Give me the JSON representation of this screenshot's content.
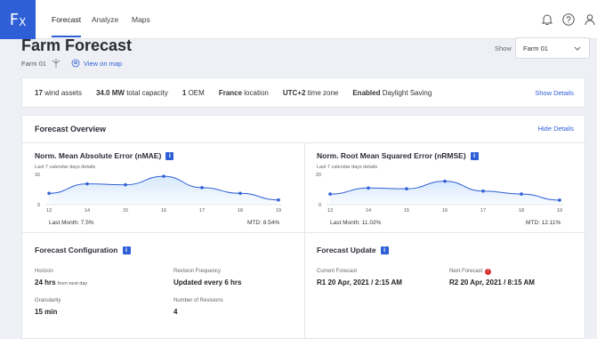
{
  "app": {
    "logo": "F",
    "logo_sub": "X"
  },
  "nav": {
    "tabs": [
      {
        "label": "Forecast"
      },
      {
        "label": "Analyze"
      },
      {
        "label": "Maps"
      }
    ]
  },
  "header": {
    "title": "Farm Forecast",
    "farm": "Farm 01",
    "map_link": "View on map",
    "show_label": "Show",
    "selected_farm": "Farm 01"
  },
  "summary": {
    "assets_count": "17",
    "assets_label": "wind assets",
    "capacity": "34.0 MW",
    "capacity_label": "total capacity",
    "oem_count": "1",
    "oem_label": "OEM",
    "location": "France",
    "location_label": "location",
    "tz": "UTC+2",
    "tz_label": "time zone",
    "dst_state": "Enabled",
    "dst_label": "Daylight Saving",
    "show_details": "Show Details"
  },
  "overview": {
    "title": "Forecast Overview",
    "hide_details": "Hide Details",
    "nmae": {
      "title": "Norm. Mean Absolute Error (nMAE)",
      "subtitle": "Last 7 calendar days details",
      "last_month": "Last Month: 7.5%",
      "mtd": "MTD: 8.54%"
    },
    "nrmse": {
      "title": "Norm. Root Mean Squared Error (nRMSE)",
      "subtitle": "Last 7 calendar days details",
      "last_month": "Last Month: 11.02%",
      "mtd": "MTD: 12.11%"
    }
  },
  "config": {
    "title": "Forecast Configuration",
    "horizon_label": "Horizon",
    "horizon_value": "24 hrs",
    "horizon_suffix": "from next day",
    "revision_label": "Revision Frequency",
    "revision_value": "Updated every 6 hrs",
    "granularity_label": "Granularity",
    "granularity_value": "15 min",
    "revisions_label": "Number of Revisions",
    "revisions_value": "4"
  },
  "update": {
    "title": "Forecast Update",
    "current_label": "Current Forecast",
    "current_value": "R1 20 Apr, 2021 / 2:15 AM",
    "next_label": "Next Forecast",
    "next_value": "R2 20 Apr, 2021 / 8:15 AM",
    "next_badge": "!"
  },
  "colors": {
    "accent": "#2f5fd6",
    "line": "#2f5fd6",
    "fill": "#d7e8fb",
    "alert": "#d93030"
  },
  "chart_data": [
    {
      "type": "area",
      "title": "Norm. Mean Absolute Error (nMAE)",
      "x": [
        13,
        14,
        15,
        16,
        17,
        18,
        19
      ],
      "values": [
        6,
        11,
        10.5,
        15,
        9,
        6,
        2.5
      ],
      "ylim": [
        0,
        16
      ],
      "yticks": [
        0,
        16
      ]
    },
    {
      "type": "area",
      "title": "Norm. Root Mean Squared Error (nRMSE)",
      "x": [
        13,
        14,
        15,
        16,
        17,
        18,
        19
      ],
      "values": [
        7,
        11,
        10.5,
        15.5,
        9,
        7,
        3
      ],
      "ylim": [
        0,
        20
      ],
      "yticks": [
        0,
        20
      ]
    }
  ]
}
